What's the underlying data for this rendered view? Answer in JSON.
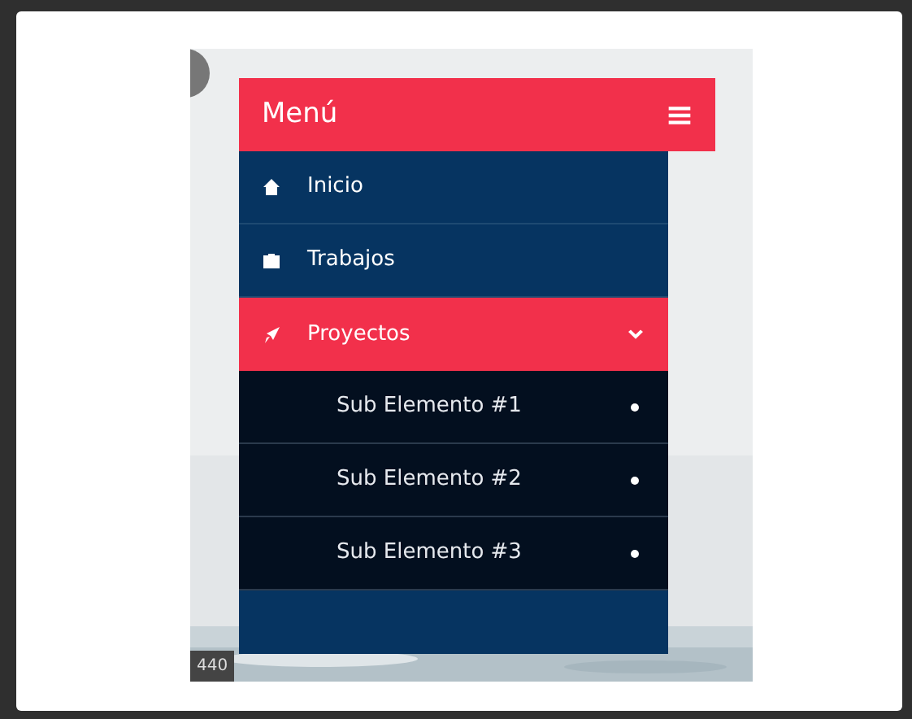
{
  "menu": {
    "title": "Menú",
    "items": [
      {
        "label": "Inicio",
        "kind": "home",
        "selected": false
      },
      {
        "label": "Trabajos",
        "kind": "briefcase",
        "selected": false
      },
      {
        "label": "Proyectos",
        "kind": "rocket",
        "selected": true,
        "expanded": true,
        "children": [
          {
            "label": "Sub Elemento #1"
          },
          {
            "label": "Sub Elemento #2"
          },
          {
            "label": "Sub Elemento #3"
          }
        ]
      }
    ]
  },
  "size_badge": "440"
}
